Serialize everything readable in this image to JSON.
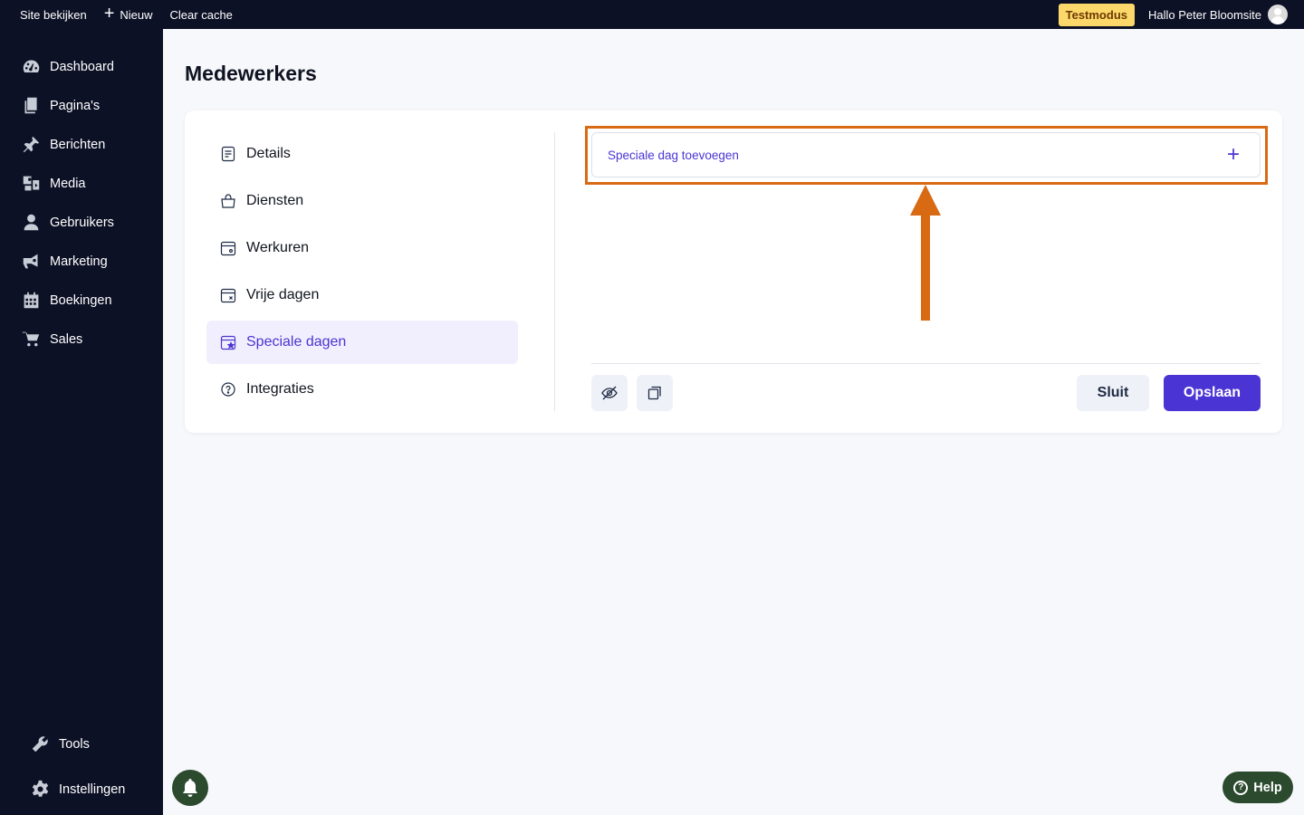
{
  "topbar": {
    "site_link": "Site bekijken",
    "new_label": "Nieuw",
    "clear_cache": "Clear cache",
    "test_badge": "Testmodus",
    "greeting": "Hallo Peter Bloomsite"
  },
  "sidebar": {
    "items": [
      {
        "label": "Dashboard",
        "icon": "dashboard-icon"
      },
      {
        "label": "Pagina's",
        "icon": "pages-icon"
      },
      {
        "label": "Berichten",
        "icon": "pin-icon"
      },
      {
        "label": "Media",
        "icon": "media-icon"
      },
      {
        "label": "Gebruikers",
        "icon": "user-icon"
      },
      {
        "label": "Marketing",
        "icon": "megaphone-icon"
      },
      {
        "label": "Boekingen",
        "icon": "calendar-icon"
      },
      {
        "label": "Sales",
        "icon": "cart-icon"
      }
    ],
    "bottom": [
      {
        "label": "Tools",
        "icon": "wrench-icon"
      },
      {
        "label": "Instellingen",
        "icon": "gear-icon"
      }
    ]
  },
  "page": {
    "title": "Medewerkers"
  },
  "tabs": [
    {
      "label": "Details",
      "icon": "document-icon",
      "active": false
    },
    {
      "label": "Diensten",
      "icon": "bag-icon",
      "active": false
    },
    {
      "label": "Werkuren",
      "icon": "calendar-clock-icon",
      "active": false
    },
    {
      "label": "Vrije dagen",
      "icon": "calendar-x-icon",
      "active": false
    },
    {
      "label": "Speciale dagen",
      "icon": "calendar-star-icon",
      "active": true
    },
    {
      "label": "Integraties",
      "icon": "integration-icon",
      "active": false
    }
  ],
  "special_days": {
    "add_label": "Speciale dag toevoegen"
  },
  "actions": {
    "close_label": "Sluit",
    "save_label": "Opslaan"
  },
  "help": {
    "label": "Help"
  },
  "colors": {
    "accent": "#4b34d4",
    "sidebar_bg": "#0d1126",
    "annotation": "#d96a14",
    "help_bg": "#2b4a2e"
  }
}
